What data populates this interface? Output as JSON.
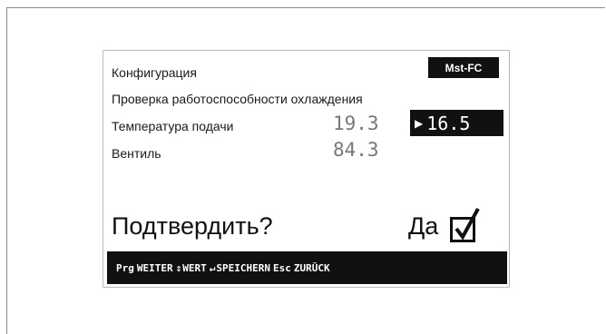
{
  "header": {
    "title": "Конфигурация",
    "badge": "Mst-FC"
  },
  "screen": {
    "subtitle": "Проверка работоспособности охлаждения",
    "rows": [
      {
        "label": "Температура подачи",
        "value": "19.3",
        "setpoint": "16.5"
      },
      {
        "label": "Вентиль",
        "value": "84.3"
      }
    ],
    "confirm_prompt": "Подтвердить?",
    "confirm_answer": "Да",
    "confirm_checked": true
  },
  "footer": {
    "prg_key": "Prg",
    "prg_action": "WEITER",
    "updown_icon": "up-down-arrows-icon",
    "updown_action": "WERT",
    "enter_icon": "enter-icon",
    "enter_action": "SPEICHERN",
    "esc_key": "Esc",
    "esc_action": "ZURÜCK"
  },
  "colors": {
    "lcd_dark": "#111111",
    "value_gray": "#777777"
  }
}
